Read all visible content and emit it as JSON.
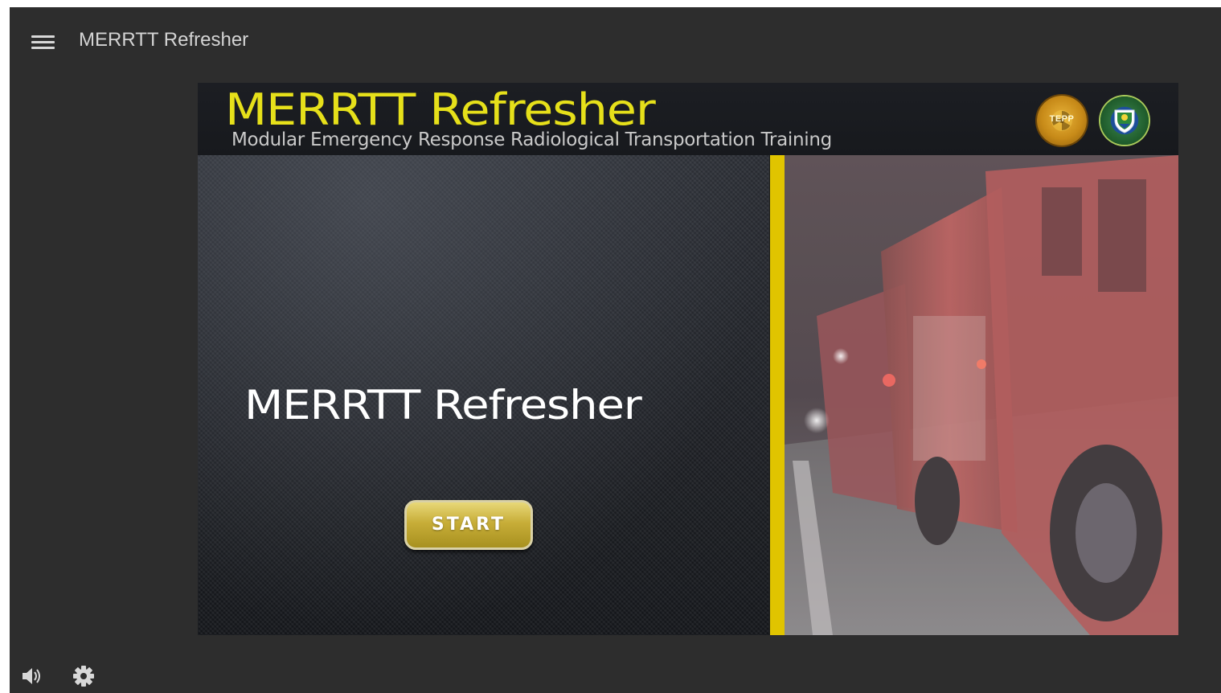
{
  "header": {
    "menu_icon": "hamburger-menu-icon",
    "title": "MERRTT Refresher"
  },
  "banner": {
    "title": "MERRTT Refresher",
    "subtitle": "Modular Emergency Response Radiological Transportation Training",
    "logos": [
      {
        "name": "tepp-logo",
        "text": "TEPP"
      },
      {
        "name": "doe-seal-logo"
      }
    ],
    "accent_color": "#e6e01a"
  },
  "main": {
    "course_title": "MERRTT Refresher",
    "start_label": "START",
    "divider_color": "#e0c400",
    "photo": "fire-trucks-at-night-image"
  },
  "footer": {
    "volume_icon": "volume-icon",
    "settings_icon": "gear-icon"
  }
}
